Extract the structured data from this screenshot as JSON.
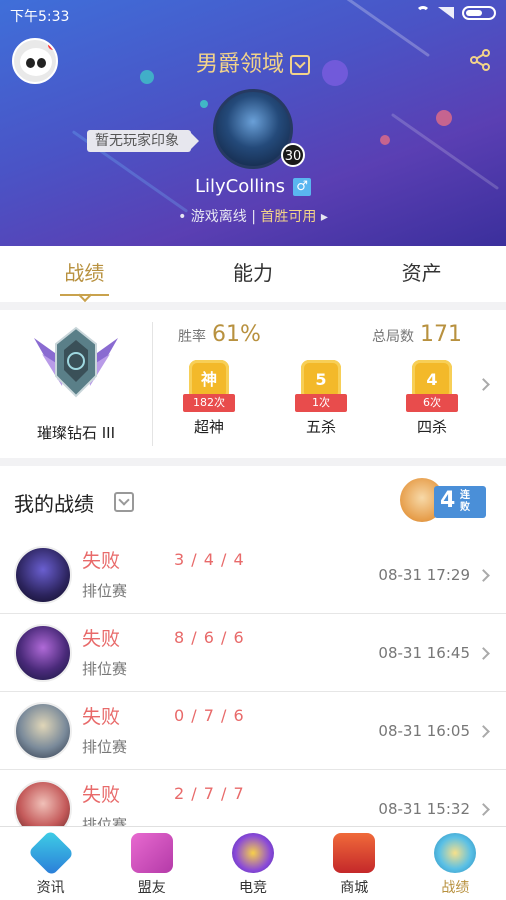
{
  "status_bar": {
    "time": "下午5:33"
  },
  "header": {
    "region": "男爵领域",
    "impression": "暂无玩家印象",
    "level": "30",
    "username": "LilyCollins",
    "gender_symbol": "♂",
    "status_left": "游戏离线",
    "status_sep": "|",
    "status_right": "首胜可用",
    "status_arrow": "▸",
    "bullet": "•"
  },
  "tabs": [
    "战绩",
    "能力",
    "资产"
  ],
  "rank": {
    "name": "璀璨钻石 III",
    "winrate_label": "胜率",
    "winrate_value": "61%",
    "total_label": "总局数",
    "total_value": "171",
    "features": [
      {
        "glyph": "神",
        "count": "182次",
        "label": "超神"
      },
      {
        "glyph": "5",
        "count": "1次",
        "label": "五杀"
      },
      {
        "glyph": "4",
        "count": "6次",
        "label": "四杀"
      }
    ]
  },
  "matches": {
    "title": "我的战绩",
    "streak_number": "4",
    "streak_text": "连败",
    "rows": [
      {
        "result": "失败",
        "kda": "3 / 4 / 4",
        "mode": "排位赛",
        "time": "08-31 17:29"
      },
      {
        "result": "失败",
        "kda": "8 / 6 / 6",
        "mode": "排位赛",
        "time": "08-31 16:45"
      },
      {
        "result": "失败",
        "kda": "0 / 7 / 6",
        "mode": "排位赛",
        "time": "08-31 16:05"
      },
      {
        "result": "失败",
        "kda": "2 / 7 / 7",
        "mode": "排位赛",
        "time": "08-31 15:32"
      }
    ]
  },
  "bottom_nav": [
    {
      "label": "资讯",
      "icon": "news-icon"
    },
    {
      "label": "盟友",
      "icon": "friends-icon"
    },
    {
      "label": "电竞",
      "icon": "esports-icon"
    },
    {
      "label": "商城",
      "icon": "store-icon"
    },
    {
      "label": "战绩",
      "icon": "record-icon"
    }
  ],
  "colors": {
    "accent_gold": "#b8913f",
    "loss_red": "#e86a6a",
    "header_blue": "#4a54c6"
  }
}
